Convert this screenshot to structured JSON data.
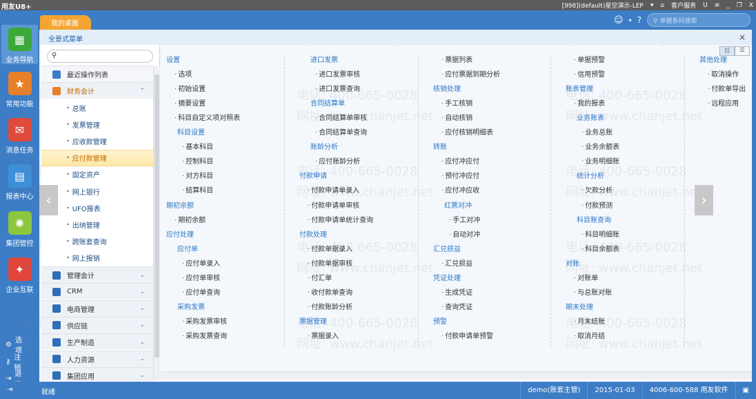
{
  "app": {
    "title": "用友U8+",
    "account": "[998](default)星空演示-LEP",
    "service": "客户服务",
    "minimize": "_",
    "restore": "❐",
    "close": "X"
  },
  "header": {
    "tab_home": "我的桌面",
    "search_placeholder": "单据条码搜索",
    "panel_title": "全景式菜单"
  },
  "left_nav": [
    {
      "label": "业务导航",
      "color": "#3aa93a",
      "glyph": "▦"
    },
    {
      "label": "常用功能",
      "color": "#e8802a",
      "glyph": "★"
    },
    {
      "label": "消息任务",
      "color": "#e04a3c",
      "glyph": "✉"
    },
    {
      "label": "报表中心",
      "color": "#3d8fd8",
      "glyph": "▤"
    },
    {
      "label": "集团管控",
      "color": "#8cc63f",
      "glyph": "✺"
    },
    {
      "label": "企业互联",
      "color": "#e2453a",
      "glyph": "✦"
    }
  ],
  "left_bottom": [
    {
      "label": "选项",
      "icon": "gear-icon",
      "glyph": "⚙"
    },
    {
      "label": "注销",
      "icon": "key-icon",
      "glyph": "⚷"
    },
    {
      "label": "退出",
      "icon": "exit-icon",
      "glyph": "⇥"
    }
  ],
  "menu": {
    "recent": "最近操作列表",
    "finance": "财务会计",
    "finance_items": [
      "总账",
      "发票管理",
      "应收款管理",
      "应付款管理",
      "固定资产",
      "网上银行",
      "UFO报表",
      "出纳管理",
      "跨账套查询",
      "网上报销"
    ],
    "selected": "应付款管理",
    "categories": [
      "管理会计",
      "CRM",
      "电商管理",
      "供应链",
      "生产制造",
      "人力资源",
      "集团应用"
    ]
  },
  "columns": [
    [
      {
        "t": "设置",
        "k": "h"
      },
      {
        "t": "选项",
        "k": "i"
      },
      {
        "t": "初始设置",
        "k": "i"
      },
      {
        "t": "摘要设置",
        "k": "i"
      },
      {
        "t": "科目自定义项对照表",
        "k": "i"
      },
      {
        "t": "科目设置",
        "k": "s"
      },
      {
        "t": "基本科目",
        "k": "j"
      },
      {
        "t": "控制科目",
        "k": "j"
      },
      {
        "t": "对方科目",
        "k": "j"
      },
      {
        "t": "结算科目",
        "k": "j"
      },
      {
        "t": "期初余额",
        "k": "h"
      },
      {
        "t": "期初余额",
        "k": "i"
      },
      {
        "t": "应付处理",
        "k": "h"
      },
      {
        "t": "应付单",
        "k": "s"
      },
      {
        "t": "应付单录入",
        "k": "j"
      },
      {
        "t": "应付单审核",
        "k": "j"
      },
      {
        "t": "应付单查询",
        "k": "j"
      },
      {
        "t": "采购发票",
        "k": "s"
      },
      {
        "t": "采购发票审核",
        "k": "j"
      },
      {
        "t": "采购发票查询",
        "k": "j"
      }
    ],
    [
      {
        "t": "进口发票",
        "k": "s"
      },
      {
        "t": "进口发票审核",
        "k": "j"
      },
      {
        "t": "进口发票查询",
        "k": "j"
      },
      {
        "t": "合同结算单",
        "k": "s"
      },
      {
        "t": "合同结算单审核",
        "k": "j"
      },
      {
        "t": "合同结算单查询",
        "k": "j"
      },
      {
        "t": "账龄分析",
        "k": "s"
      },
      {
        "t": "应付账龄分析",
        "k": "j"
      },
      {
        "t": "付款申请",
        "k": "h"
      },
      {
        "t": "付款申请单录入",
        "k": "i"
      },
      {
        "t": "付款申请单审核",
        "k": "i"
      },
      {
        "t": "付款申请单统计查询",
        "k": "i"
      },
      {
        "t": "付款处理",
        "k": "h"
      },
      {
        "t": "付款单据录入",
        "k": "i"
      },
      {
        "t": "付款单据审核",
        "k": "i"
      },
      {
        "t": "付汇单",
        "k": "i"
      },
      {
        "t": "收付款单查询",
        "k": "i"
      },
      {
        "t": "付款账龄分析",
        "k": "i"
      },
      {
        "t": "票据管理",
        "k": "h"
      },
      {
        "t": "票据录入",
        "k": "i"
      }
    ],
    [
      {
        "t": "票据列表",
        "k": "i"
      },
      {
        "t": "应付票据到期分析",
        "k": "i"
      },
      {
        "t": "核销处理",
        "k": "h"
      },
      {
        "t": "手工核销",
        "k": "i"
      },
      {
        "t": "自动核销",
        "k": "i"
      },
      {
        "t": "应付核销明细表",
        "k": "i"
      },
      {
        "t": "转账",
        "k": "h"
      },
      {
        "t": "应付冲应付",
        "k": "i"
      },
      {
        "t": "预付冲应付",
        "k": "i"
      },
      {
        "t": "应付冲应收",
        "k": "i"
      },
      {
        "t": "红票对冲",
        "k": "s"
      },
      {
        "t": "手工对冲",
        "k": "j"
      },
      {
        "t": "自动对冲",
        "k": "j"
      },
      {
        "t": "汇兑损益",
        "k": "h"
      },
      {
        "t": "汇兑损益",
        "k": "i"
      },
      {
        "t": "凭证处理",
        "k": "h"
      },
      {
        "t": "生成凭证",
        "k": "i"
      },
      {
        "t": "查询凭证",
        "k": "i"
      },
      {
        "t": "预警",
        "k": "h"
      },
      {
        "t": "付款申请单预警",
        "k": "i"
      }
    ],
    [
      {
        "t": "单据预警",
        "k": "i"
      },
      {
        "t": "信用预警",
        "k": "i"
      },
      {
        "t": "账表管理",
        "k": "h"
      },
      {
        "t": "我的报表",
        "k": "i"
      },
      {
        "t": "业务账表",
        "k": "s"
      },
      {
        "t": "业务总账",
        "k": "j"
      },
      {
        "t": "业务余额表",
        "k": "j"
      },
      {
        "t": "业务明细账",
        "k": "j"
      },
      {
        "t": "统计分析",
        "k": "s"
      },
      {
        "t": "欠款分析",
        "k": "j"
      },
      {
        "t": "付款预测",
        "k": "j"
      },
      {
        "t": "科目账查询",
        "k": "s"
      },
      {
        "t": "科目明细账",
        "k": "j"
      },
      {
        "t": "科目余额表",
        "k": "j"
      },
      {
        "t": "对账",
        "k": "h"
      },
      {
        "t": "对账单",
        "k": "i"
      },
      {
        "t": "与总账对账",
        "k": "i"
      },
      {
        "t": "期末处理",
        "k": "h"
      },
      {
        "t": "月末结账",
        "k": "i"
      },
      {
        "t": "取消月结",
        "k": "i"
      }
    ],
    [
      {
        "t": "其他处理",
        "k": "h"
      },
      {
        "t": "取消操作",
        "k": "i"
      },
      {
        "t": "付款单导出",
        "k": "i"
      },
      {
        "t": "远程应用",
        "k": "i"
      }
    ]
  ],
  "watermark": {
    "phone": "电话: 400-665-0028",
    "site": "网址: www.chanjet.net"
  },
  "status": {
    "ready": "就绪",
    "user": "demo(账套主管)",
    "date": "2015-01-03",
    "hotline": "4006-600-588 用友软件"
  }
}
